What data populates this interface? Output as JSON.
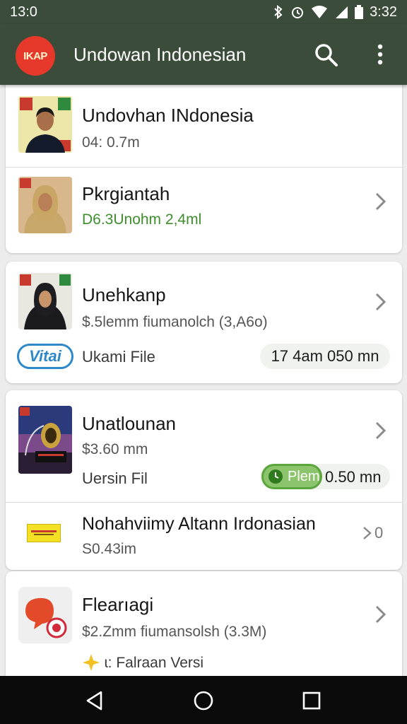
{
  "status_bar": {
    "time_left": "13:0",
    "time_right": "3:32",
    "icons": [
      "bluetooth-icon",
      "alarm-icon",
      "wifi-icon",
      "signal-icon",
      "battery-icon"
    ]
  },
  "app_bar": {
    "logo_text": "IKAP",
    "title": "Undowan Indonesian",
    "icons": [
      "search-icon",
      "more-vert-icon"
    ]
  },
  "items": [
    {
      "title": "Undovhan INdonesia",
      "subtitle": "04: 0.7m",
      "thumb": "portrait-man"
    },
    {
      "title": "Pkrgiantah",
      "subtitle": "D6.3Unohm 2,4ml",
      "subtitle_color": "#3e8e2e",
      "thumb": "portrait-woman-hijab"
    },
    {
      "title": "Unehkanp",
      "subtitle": "$.5lemm fiumanolch (3,A6o)",
      "badge": "Vitai",
      "file_label": "Ukami File",
      "time": "17 4am 050 mn",
      "thumb": "portrait-woman-dark"
    },
    {
      "title": "Unatlounan",
      "subtitle": "$3.60 mm",
      "file_label": "Uersin Fil",
      "badge": "Plem",
      "time": "0.50 mn",
      "thumb": "monument-night"
    },
    {
      "title": "Nohahviimy Altann Irdonasian",
      "subtitle": "S0.43im",
      "trailing": "0",
      "thumb": "yellow-label"
    },
    {
      "title": "Flearıagi",
      "subtitle": "$2.Zmm fiumansolsh (3.3M)",
      "note": "ɩ: Falraan Versi",
      "thumb": "red-speech-app"
    }
  ],
  "colors": {
    "app_bar": "#3b4c3a",
    "nav_bar": "#0b0b0b",
    "accent_blue": "#2e88c8",
    "accent_green": "#5aa63c",
    "logo_red": "#e6382b"
  },
  "nav": [
    "back-icon",
    "home-icon",
    "recents-icon"
  ]
}
